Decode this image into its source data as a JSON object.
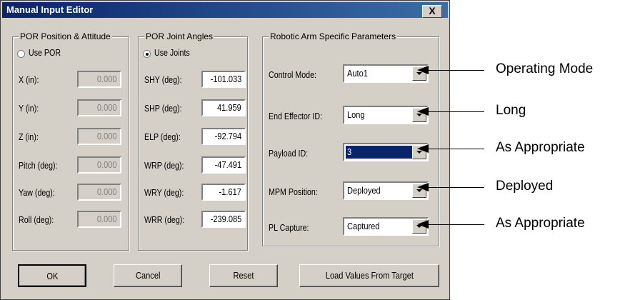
{
  "window": {
    "title": "Manual Input Editor",
    "close_label": "X"
  },
  "por_position": {
    "legend": "POR Position & Attitude",
    "radio_label": "Use POR",
    "fields": [
      {
        "label": "X (in):",
        "value": "0.000"
      },
      {
        "label": "Y (in):",
        "value": "0.000"
      },
      {
        "label": "Z (in):",
        "value": "0.000"
      },
      {
        "label": "Pitch (deg):",
        "value": "0.000"
      },
      {
        "label": "Yaw (deg):",
        "value": "0.000"
      },
      {
        "label": "Roll (deg):",
        "value": "0.000"
      }
    ]
  },
  "joint_angles": {
    "legend": "POR Joint Angles",
    "radio_label": "Use Joints",
    "fields": [
      {
        "label": "SHY (deg):",
        "value": "-101.033"
      },
      {
        "label": "SHP (deg):",
        "value": "41.959"
      },
      {
        "label": "ELP (deg):",
        "value": "-92.794"
      },
      {
        "label": "WRP (deg):",
        "value": "-47.491"
      },
      {
        "label": "WRY (deg):",
        "value": "-1.617"
      },
      {
        "label": "WRR (deg):",
        "value": "-239.085"
      }
    ]
  },
  "arm_params": {
    "legend": "Robotic Arm Specific Parameters",
    "rows": [
      {
        "label": "Control Mode:",
        "value": "Auto1"
      },
      {
        "label": "End Effector ID:",
        "value": "Long"
      },
      {
        "label": "Payload ID:",
        "value": "3"
      },
      {
        "label": "MPM Position:",
        "value": "Deployed"
      },
      {
        "label": "PL Capture:",
        "value": "Captured"
      }
    ]
  },
  "buttons": {
    "ok": "OK",
    "cancel": "Cancel",
    "reset": "Reset",
    "load": "Load Values From Target"
  },
  "annotations": [
    "Operating Mode",
    "Long",
    "As Appropriate",
    "Deployed",
    "As Appropriate"
  ]
}
